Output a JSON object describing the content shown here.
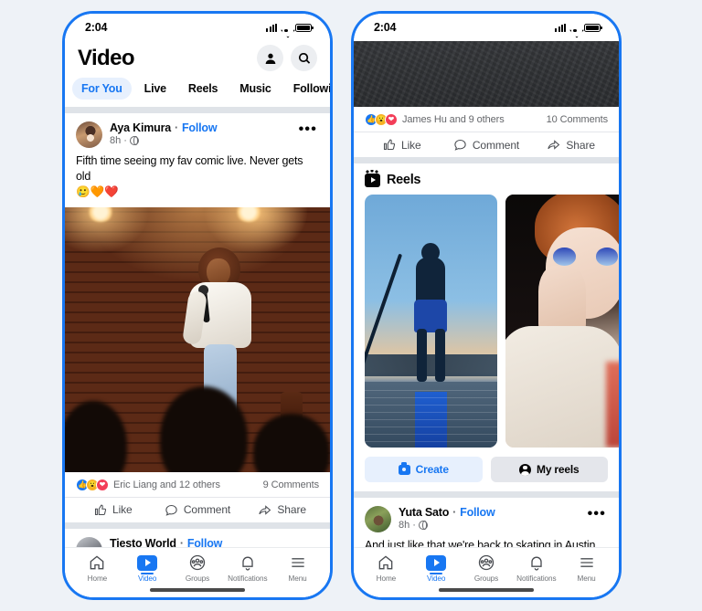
{
  "status_bar": {
    "time": "2:04",
    "signal_icon": "cellular-signal-icon",
    "wifi_icon": "wifi-icon",
    "battery_icon": "battery-icon"
  },
  "left_phone": {
    "header": {
      "title": "Video",
      "profile_icon": "profile-icon",
      "search_icon": "search-icon"
    },
    "tabs": [
      {
        "label": "For You",
        "active": true
      },
      {
        "label": "Live",
        "active": false
      },
      {
        "label": "Reels",
        "active": false
      },
      {
        "label": "Music",
        "active": false
      },
      {
        "label": "Following",
        "active": false
      }
    ],
    "post": {
      "author": "Aya Kimura",
      "separator": "·",
      "follow_label": "Follow",
      "time": "8h",
      "meta_dot": "·",
      "privacy_icon": "globe-icon",
      "menu_icon": "more-options-icon",
      "body": "Fifth time seeing my fav comic live. Never gets old",
      "emojis": "🥲🧡❤️",
      "media_alt": "comedian on stage with microphone in front of brick wall",
      "reactions": {
        "icons": [
          "like-reaction-icon",
          "wow-reaction-icon",
          "love-reaction-icon"
        ],
        "summary": "Eric Liang and 12 others"
      },
      "comments": "9 Comments",
      "actions": [
        {
          "label": "Like",
          "icon": "thumbs-up-icon"
        },
        {
          "label": "Comment",
          "icon": "comment-bubble-icon"
        },
        {
          "label": "Share",
          "icon": "share-arrow-icon"
        }
      ]
    },
    "next_post_peek": {
      "author": "Tiesto World",
      "separator": "·",
      "follow_label": "Follow"
    }
  },
  "right_phone": {
    "top_video_alt": "dark textured video still",
    "post": {
      "reactions": {
        "icons": [
          "like-reaction-icon",
          "wow-reaction-icon",
          "love-reaction-icon"
        ],
        "summary": "James Hu and 9 others"
      },
      "comments": "10 Comments",
      "actions": [
        {
          "label": "Like",
          "icon": "thumbs-up-icon"
        },
        {
          "label": "Comment",
          "icon": "comment-bubble-icon"
        },
        {
          "label": "Share",
          "icon": "share-arrow-icon"
        }
      ]
    },
    "reels": {
      "section_icon": "reels-clapperboard-icon",
      "title": "Reels",
      "items": [
        {
          "alt": "person paddleboarding at dusk"
        },
        {
          "alt": "person applying blue eyeshadow makeup"
        }
      ],
      "buttons": [
        {
          "label": "Create",
          "icon": "camera-icon"
        },
        {
          "label": "My reels",
          "icon": "profile-circle-icon"
        }
      ]
    },
    "bottom_post": {
      "author": "Yuta Sato",
      "separator": "·",
      "follow_label": "Follow",
      "time": "8h",
      "meta_dot": "·",
      "privacy_icon": "globe-icon",
      "menu_icon": "more-options-icon",
      "body": "And just like that we're back to skating in Austin"
    }
  },
  "bottom_nav": [
    {
      "label": "Home",
      "icon": "home-icon",
      "active": false
    },
    {
      "label": "Video",
      "icon": "video-icon",
      "active": true
    },
    {
      "label": "Groups",
      "icon": "groups-icon",
      "active": false
    },
    {
      "label": "Notifications",
      "icon": "bell-icon",
      "active": false
    },
    {
      "label": "Menu",
      "icon": "hamburger-menu-icon",
      "active": false
    }
  ],
  "colors": {
    "brand_blue": "#1877f2",
    "page_background": "#eef2f7",
    "text_primary": "#050505",
    "text_secondary": "#65676b"
  }
}
